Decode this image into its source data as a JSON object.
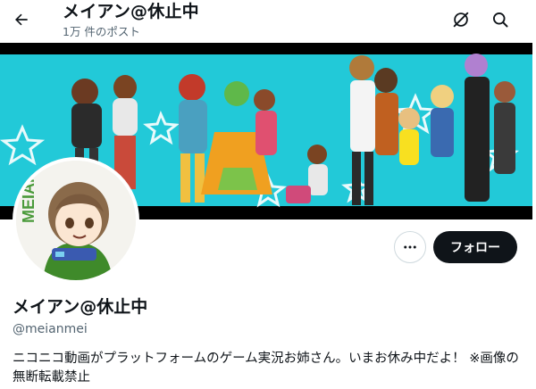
{
  "header": {
    "title": "メイアン@休止中",
    "post_count": "1万 件のポスト",
    "icons": [
      "arrow-left-icon",
      "grok-icon",
      "search-icon"
    ]
  },
  "profile": {
    "display_name": "メイアン@休止中",
    "handle": "@meianmei",
    "bio": "ニコニコ動画がプラットフォームのゲーム実況お姉さん。いまお休み中だよ！ ※画像の無断転載禁止",
    "avatar_text": "MEIAN"
  },
  "actions": {
    "more_icon": "more-dots-icon",
    "follow_label": "フォロー"
  },
  "colors": {
    "banner_bg": "#1ec8d6",
    "follow_bg": "#0f1419",
    "secondary_text": "#536471"
  }
}
